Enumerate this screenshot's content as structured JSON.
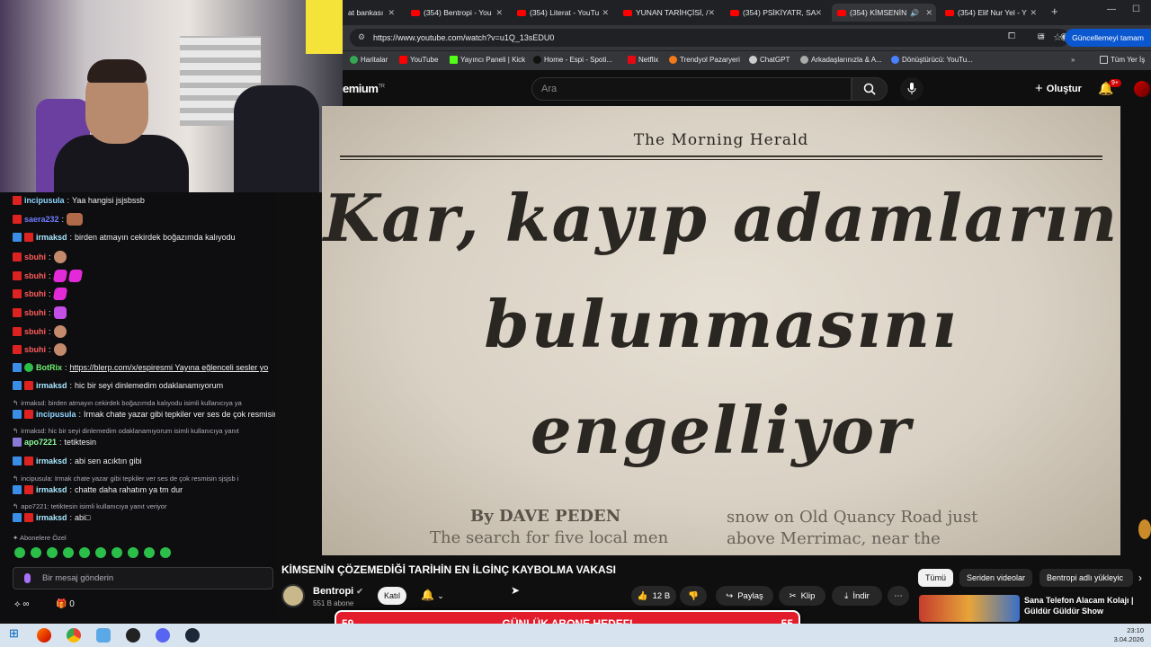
{
  "browser": {
    "tabs": [
      {
        "label": "at bankası"
      },
      {
        "label": "(354) Bentropi - You"
      },
      {
        "label": "(354) Literat - YouTu"
      },
      {
        "label": "YUNAN TARİHÇİSİ, /"
      },
      {
        "label": "(354) PSİKİYATR, SA"
      },
      {
        "label": "(354) KİMSENİN"
      },
      {
        "label": "(354) Elif Nur Yel - Y"
      }
    ],
    "url": "https://www.youtube.com/watch?v=u1Q_13sEDU0",
    "update_button": "Güncellemeyi tamam",
    "bookmarks": [
      "Haritalar",
      "YouTube",
      "Yayıncı Paneli | Kick",
      "Home - Espi - Spoti...",
      "Netflix",
      "Trendyol Pazaryeri",
      "ChatGPT",
      "Arkadaşlarınızla & A...",
      "Dönüştürücü: YouTu..."
    ],
    "bookmarks_all": "Tüm Yer İş"
  },
  "youtube": {
    "logo": "emium",
    "logo_sup": "TR",
    "search_placeholder": "Ara",
    "create_label": "Oluştur",
    "notif_count": "9+",
    "video": {
      "masthead": "The Morning Herald",
      "headline": [
        "Kar, kayıp adamların",
        "bulunmasını",
        "engelliyor"
      ],
      "byline": "By DAVE PEDEN",
      "body_left": "The search for five local men",
      "body_right": [
        "snow on Old Quancy Road just",
        "above Merrimac, near the"
      ]
    },
    "title": "KİMSENİN ÇÖZEMEDİĞİ TARİHİN EN İLGİNÇ KAYBOLMA VAKASI",
    "channel": "Bentropi",
    "subscribers": "551 B abone",
    "join": "Katıl",
    "likes": "12 B",
    "share": "Paylaş",
    "clip": "Klip",
    "download": "İndir",
    "filters": [
      "Tümü",
      "Seriden videolar",
      "Bentropi adlı yükleyic"
    ],
    "rec_title": "Sana Telefon Alacam Kolajı | Güldür Güldür Show"
  },
  "chat": {
    "messages": [
      {
        "user": "incipusula",
        "color": "#8fd5ff",
        "text": "Yaa hangisi jsjsbssb"
      },
      {
        "user": "saera232",
        "color": "#6f7cff",
        "text": ""
      },
      {
        "user": "irmaksd",
        "color": "#a9e8ff",
        "text": "birden atmayın cekirdek boğazımda kalıyodu"
      },
      {
        "user": "sbuhi",
        "color": "#ff5b5b",
        "text": ""
      },
      {
        "user": "sbuhi",
        "color": "#ff5b5b",
        "text": ""
      },
      {
        "user": "sbuhi",
        "color": "#ff5b5b",
        "text": ""
      },
      {
        "user": "sbuhi",
        "color": "#ff5b5b",
        "text": ""
      },
      {
        "user": "sbuhi",
        "color": "#ff5b5b",
        "text": ""
      },
      {
        "user": "sbuhi",
        "color": "#ff5b5b",
        "text": ""
      },
      {
        "user": "BotRix",
        "color": "#6ef06e",
        "text": "https://blerp.com/x/espiresmi Yayına eğlenceli sesler yo"
      },
      {
        "user": "irmaksd",
        "color": "#a9e8ff",
        "text": "hic bir seyi dinlemedim odaklanamıyorum"
      },
      {
        "user": "incipusula",
        "color": "#8fd5ff",
        "text": "Irmak chate yazar gibi tepkiler ver ses de çok resmisin s"
      },
      {
        "user": "apo7221",
        "color": "#8fff9a",
        "text": "tetiktesin"
      },
      {
        "user": "irmaksd",
        "color": "#a9e8ff",
        "text": "abi sen acıktın gibi"
      },
      {
        "user": "irmaksd",
        "color": "#a9e8ff",
        "text": "chatte daha rahatım ya tm dur"
      },
      {
        "user": "irmaksd",
        "color": "#a9e8ff",
        "text": "abi□"
      }
    ],
    "replies": [
      "irmaksd: birden atmayın cekirdek boğazımda kalıyodu isimli kullanıcıya ya",
      "irmaksd: hic bir seyi dinlemedim odaklanamıyorum isimli kullanıcıya yanıt",
      "incipusula: Irmak chate yazar gibi tepkiler ver ses de çok resmisin sjsjsb i",
      "apo7221: tetiktesin isimli kullanıcıya yanıt veriyor"
    ],
    "subscribers_only": "Abonelere Özel",
    "input_placeholder": "Bir mesaj gönderin",
    "viewer_count": "0"
  },
  "goal": {
    "left": "59",
    "label": "GÜNLÜK ABONE HEDEFI",
    "right": "55"
  },
  "taskbar": {
    "time": "23:10",
    "date": "3.04.2026"
  }
}
